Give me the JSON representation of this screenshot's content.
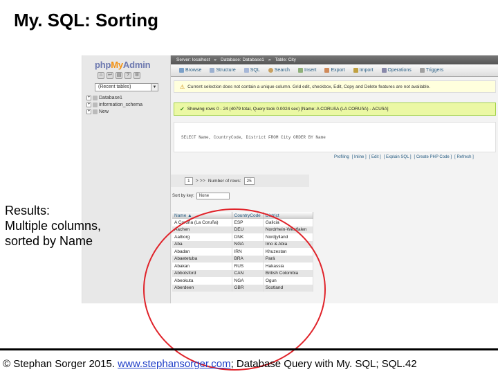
{
  "slide": {
    "title": "My. SQL: Sorting",
    "annotation": [
      "Results:",
      "Multiple columns,",
      "sorted by Name"
    ],
    "footer_prefix": "© Stephan Sorger 2015. ",
    "footer_link": "www.stephansorger.com",
    "footer_suffix": "; Database Query with My. SQL;  SQL.42",
    "accent_colors": {
      "ellipse": "#e0232a",
      "link": "#1f3ec8"
    }
  },
  "pma": {
    "logo": {
      "php": "php",
      "my": "My",
      "admin": "Admin"
    },
    "recent_tables": "(Recent tables)",
    "tree": [
      {
        "label": "Database1"
      },
      {
        "label": "information_schema"
      },
      {
        "label": "New"
      }
    ],
    "breadcrumb": [
      "Server: localhost",
      "Database: Database1",
      "Table: City"
    ],
    "tabs": [
      {
        "label": "Browse",
        "icon": "browse-icon"
      },
      {
        "label": "Structure",
        "icon": "structure-icon"
      },
      {
        "label": "SQL",
        "icon": "sql-icon"
      },
      {
        "label": "Search",
        "icon": "search-icon"
      },
      {
        "label": "Insert",
        "icon": "insert-icon"
      },
      {
        "label": "Export",
        "icon": "export-icon"
      },
      {
        "label": "Import",
        "icon": "import-icon"
      },
      {
        "label": "Operations",
        "icon": "operations-icon"
      },
      {
        "label": "Triggers",
        "icon": "triggers-icon"
      }
    ],
    "warning": "Current selection does not contain a unique column. Grid edit, checkbox, Edit, Copy and Delete features are not available.",
    "success": "Showing rows 0 - 24 (4079 total, Query took 0.0024 sec) [Name: A CORUñA (LA CORUñA) - ACUñA]",
    "sql": "SELECT Name, CountryCode, District FROM City ORDER BY Name",
    "sql_links": [
      "Profiling",
      "[ Inline ]",
      "[ Edit ]",
      "[ Explain SQL ]",
      "[ Create PHP Code ]",
      "[ Refresh ]"
    ],
    "nav": {
      "page": "1",
      "next": "> >>",
      "rows_label": "Number of rows:",
      "rows": "25"
    },
    "sort_label": "Sort by key:",
    "sort_value": "None",
    "table": {
      "headers": [
        "Name ▲",
        "CountryCode",
        "District"
      ],
      "rows": [
        [
          "A Coruña (La Coruña)",
          "ESP",
          "Galicia"
        ],
        [
          "Aachen",
          "DEU",
          "Nordrhein-Westfalen"
        ],
        [
          "Aalborg",
          "DNK",
          "Nordjylland"
        ],
        [
          "Aba",
          "NGA",
          "Imo & Abia"
        ],
        [
          "Abadan",
          "IRN",
          "Khuzestan"
        ],
        [
          "Abaetetuba",
          "BRA",
          "Pará"
        ],
        [
          "Abakan",
          "RUS",
          "Hakassia"
        ],
        [
          "Abbotsford",
          "CAN",
          "British Colombia"
        ],
        [
          "Abeokuta",
          "NGA",
          "Ogun"
        ],
        [
          "Aberdeen",
          "GBR",
          "Scotland"
        ]
      ]
    }
  }
}
